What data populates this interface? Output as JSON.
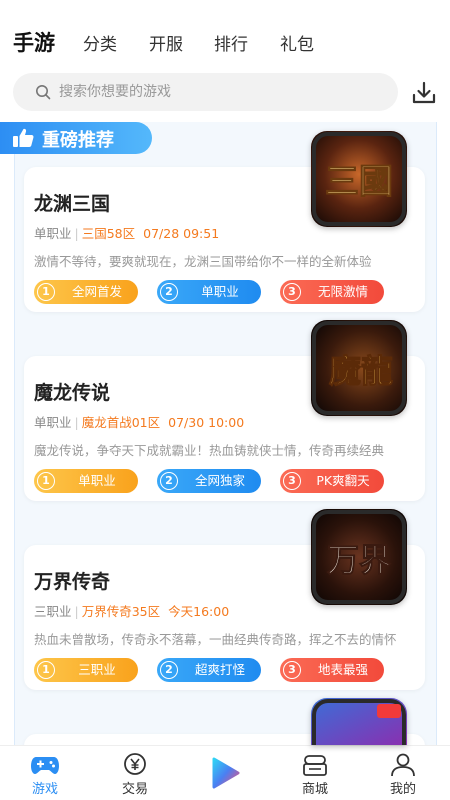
{
  "tabs": [
    {
      "label": "手游"
    },
    {
      "label": "分类"
    },
    {
      "label": "开服"
    },
    {
      "label": "排行"
    },
    {
      "label": "礼包"
    }
  ],
  "search": {
    "placeholder": "搜索你想要的游戏"
  },
  "section": {
    "title": "重磅推荐",
    "icon": "thumbs-up-icon"
  },
  "games": [
    {
      "title": "龙渊三国",
      "type": "单职业",
      "server": "三国58区",
      "time": "07/28 09:51",
      "desc": "激情不等待，要爽就现在，龙渊三国带给你不一样的全新体验",
      "cover_text": "三國",
      "tags": [
        {
          "num": "1",
          "label": "全网首发"
        },
        {
          "num": "2",
          "label": "单职业"
        },
        {
          "num": "3",
          "label": "无限激情"
        }
      ]
    },
    {
      "title": "魔龙传说",
      "type": "单职业",
      "server": "魔龙首战01区",
      "time": "07/30 10:00",
      "desc": "魔龙传说，争夺天下成就霸业！热血铸就侠士情，传奇再续经典",
      "cover_text": "魔龍",
      "tags": [
        {
          "num": "1",
          "label": "单职业"
        },
        {
          "num": "2",
          "label": "全网独家"
        },
        {
          "num": "3",
          "label": "PK爽翻天"
        }
      ]
    },
    {
      "title": "万界传奇",
      "type": "三职业",
      "server": "万界传奇35区",
      "time": "今天16:00",
      "desc": "热血未曾散场，传奇永不落幕，一曲经典传奇路，挥之不去的情怀",
      "cover_text": "万界",
      "tags": [
        {
          "num": "1",
          "label": "三职业"
        },
        {
          "num": "2",
          "label": "超爽打怪"
        },
        {
          "num": "3",
          "label": "地表最强"
        }
      ]
    }
  ],
  "bottom_nav": [
    {
      "label": "游戏",
      "icon": "gamepad-icon",
      "active": true
    },
    {
      "label": "交易",
      "icon": "trade-yen-icon"
    },
    {
      "label": "",
      "icon": "play-logo-icon"
    },
    {
      "label": "商城",
      "icon": "store-icon"
    },
    {
      "label": "我的",
      "icon": "profile-icon"
    }
  ],
  "colors": {
    "accent": "#2b8ef3",
    "orange": "#f47a1f",
    "tag_yellow": "#f9a21c",
    "tag_blue": "#1f8bf0",
    "tag_red": "#f24a3b"
  }
}
